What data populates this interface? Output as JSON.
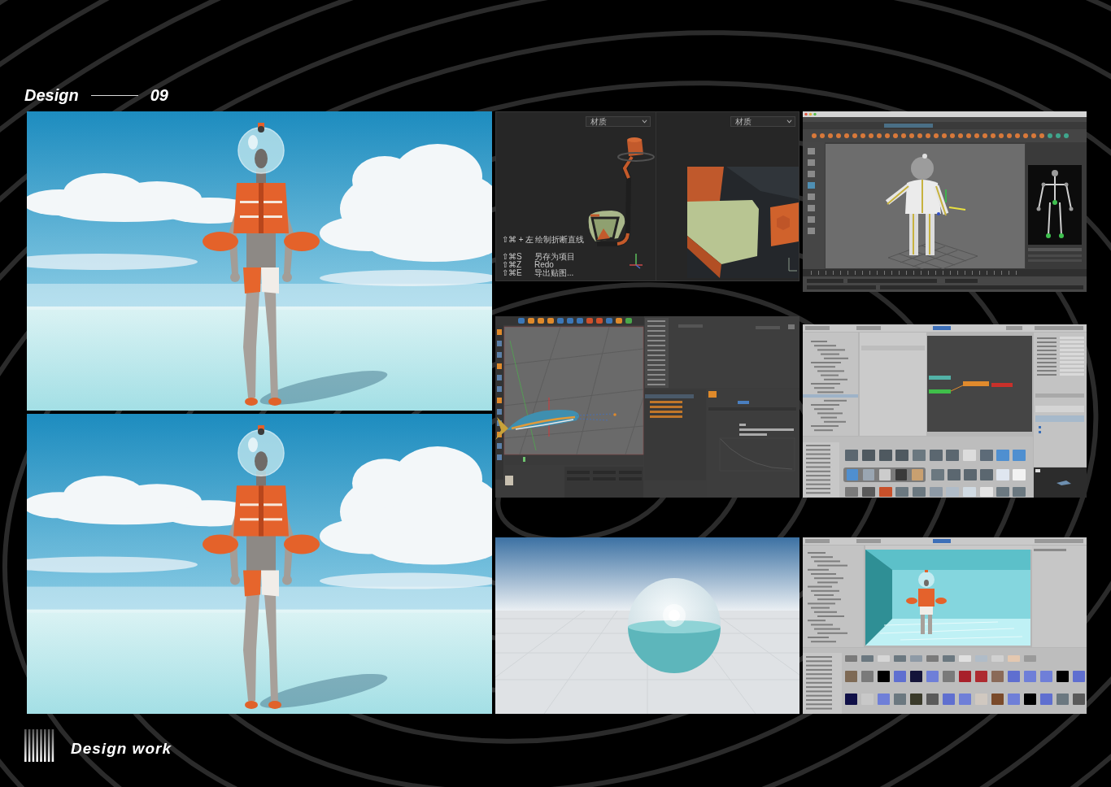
{
  "header": {
    "title": "Design",
    "page_number": "09"
  },
  "columns": [
    {
      "panels": [
        {
          "kind": "character_render"
        },
        {
          "kind": "character_render"
        }
      ]
    },
    {
      "panels": [
        {
          "kind": "texture_painter",
          "viewport": {
            "dropdown": "材质",
            "shortcuts": [
              {
                "keys": "⇧⌘ + 左",
                "action": "绘制折断直线"
              },
              {
                "keys": "⇧⌘S",
                "action": "另存为项目"
              },
              {
                "keys": "⇧⌘Z",
                "action": "Redo"
              },
              {
                "keys": "⇧⌘E",
                "action": "导出贴图..."
              }
            ]
          },
          "texture_view": {
            "dropdown": "材质"
          }
        },
        {
          "kind": "fish_editor"
        },
        {
          "kind": "sphere_render"
        }
      ]
    },
    {
      "panels": [
        {
          "kind": "rig_editor"
        },
        {
          "kind": "animator_editor"
        },
        {
          "kind": "scene_editor"
        }
      ]
    }
  ],
  "footer": {
    "title": "Design work"
  }
}
